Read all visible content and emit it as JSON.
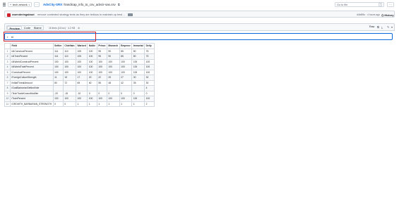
{
  "topbar": {
    "branch": "tech-rework",
    "repo": "AdvCity-SRX",
    "filename": "handicap_info_to_csv_advcir-sas.csv",
    "goto_placeholder": "Go to file",
    "goto_kbd": "t",
    "more": "⋯"
  },
  "commit": {
    "author": "owenderingabout",
    "message": "remove contested strategy texts as they are tedious to maintain up best ...",
    "icon": "···",
    "hash": "d4b6f5c · 4 hours ago",
    "history": "History"
  },
  "fileheader": {
    "tabs": [
      "Preview",
      "Code",
      "Blame"
    ],
    "active_tab": "Preview",
    "meta": "16 lines (16 loc) · 4.2 KB",
    "raw": "Raw"
  },
  "search": {
    "value": "bl",
    "placeholder": "Search this file..."
  },
  "table": {
    "headers": [
      "",
      "Field",
      "Settler",
      "Chieftain",
      "Warlord",
      "Noble",
      "Prince",
      "Monarch",
      "Emperor",
      "Immortal",
      "Deity"
    ],
    "rows": [
      [
        "1",
        "iAIConstructPercent",
        "114",
        "110",
        "105",
        "100",
        "95",
        "90",
        "85",
        "80",
        "75"
      ],
      [
        "2",
        "iAITrainPercent",
        "114",
        "110",
        "105",
        "100",
        "95",
        "90",
        "85",
        "80",
        "75"
      ],
      [
        "3",
        "iAIWorldConstructPercent",
        "100",
        "100",
        "100",
        "100",
        "100",
        "100",
        "100",
        "100",
        "100"
      ],
      [
        "4",
        "iAIWorldTrainPercent",
        "100",
        "100",
        "100",
        "100",
        "100",
        "100",
        "100",
        "100",
        "100"
      ],
      [
        "5",
        "iConstructPercent",
        "100",
        "100",
        "100",
        "100",
        "100",
        "100",
        "100",
        "100",
        "100"
      ],
      [
        "6",
        "iForeignCultureStrength",
        "11",
        "15",
        "17",
        "20",
        "22",
        "25",
        "27",
        "30",
        "32"
      ],
      [
        "7",
        "iInitialThreatAmount",
        "80",
        "72",
        "65",
        "60",
        "55",
        "48",
        "42",
        "35",
        "30"
      ],
      [
        "8",
        "iGoalBarbarianSettledVote",
        "",
        "",
        "",
        "",
        "",
        "",
        "",
        "",
        "4"
      ],
      [
        "9",
        "iTechTradeKnownModifier",
        "-20",
        "-15",
        "-10",
        "0",
        "0",
        "0",
        "0",
        "0",
        "0"
      ],
      [
        "10",
        "iTrainPercent",
        "100",
        "100",
        "100",
        "100",
        "100",
        "100",
        "100",
        "100",
        "100"
      ],
      [
        "11",
        "iGROWTH_BARBARIAN_STRENGTH",
        "0",
        "0",
        "1",
        "1",
        "1",
        "1",
        "1",
        "1",
        "2"
      ]
    ]
  },
  "colors": {
    "link": "#0969da",
    "highlight_border": "#d1242f",
    "border": "#d0d7de",
    "muted": "#59636e"
  }
}
